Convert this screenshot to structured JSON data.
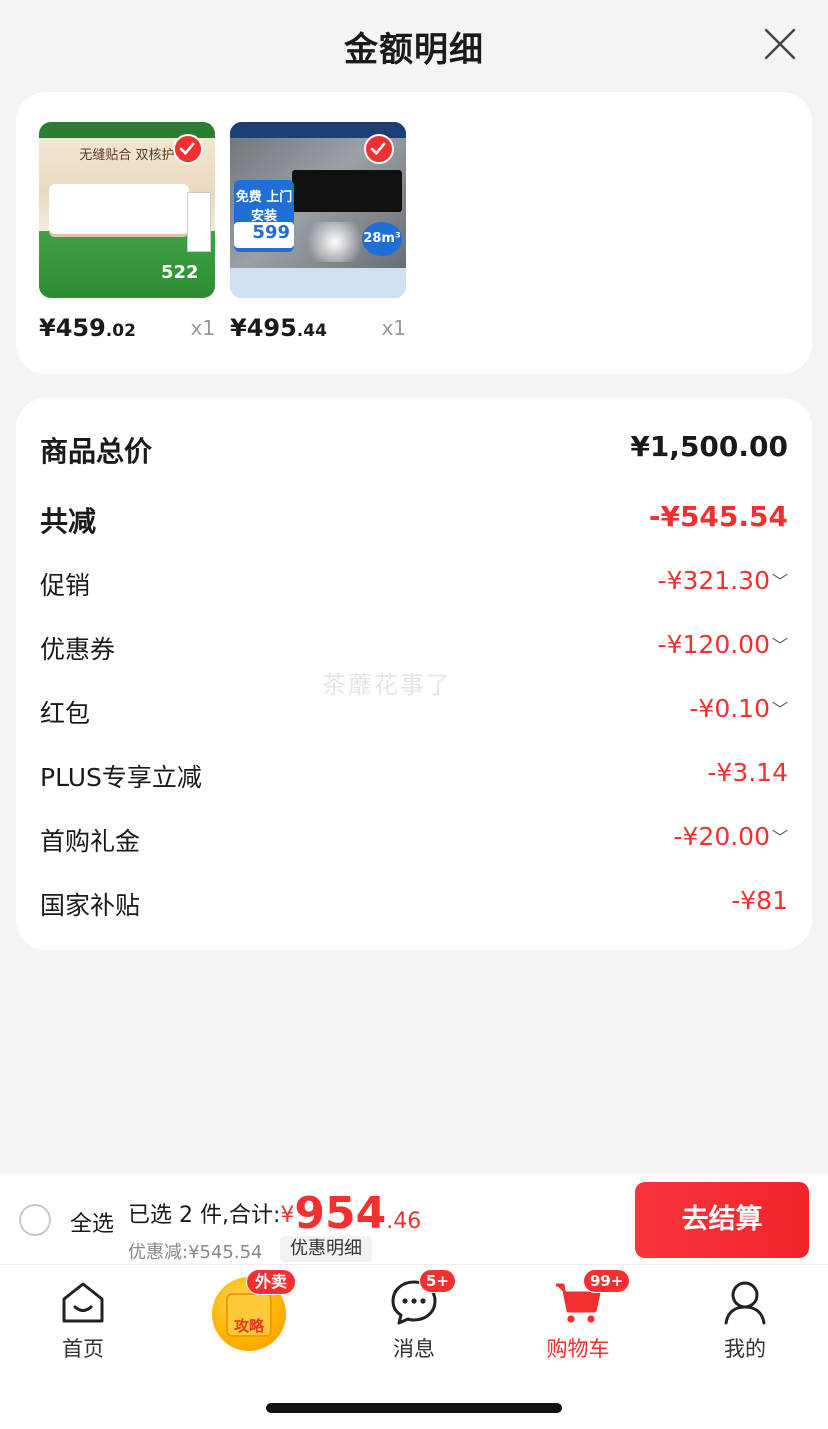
{
  "header": {
    "title": "金额明细"
  },
  "products": [
    {
      "price_main": "¥459",
      "price_dec": ".02",
      "qty": "x1",
      "checked": true,
      "thumb": {
        "headline": "无缝贴合 双核护",
        "badge": "522"
      }
    },
    {
      "price_main": "¥495",
      "price_dec": ".44",
      "qty": "x1",
      "checked": true,
      "thumb": {
        "headline": "免费 上门安装",
        "badge": "599",
        "extra": "28m³"
      }
    }
  ],
  "detail": {
    "total": {
      "label": "商品总价",
      "value": "¥1,500.00"
    },
    "reduce": {
      "label": "共减",
      "value": "-¥545.54"
    },
    "items": [
      {
        "label": "促销",
        "value": "-¥321.30",
        "chev": "﹀"
      },
      {
        "label": "优惠券",
        "value": "-¥120.00",
        "chev": "﹀"
      },
      {
        "label": "红包",
        "value": "-¥0.10",
        "chev": "﹀"
      },
      {
        "label": "PLUS专享立减",
        "value": "-¥3.14",
        "chev": ""
      },
      {
        "label": "首购礼金",
        "value": "-¥20.00",
        "chev": "﹀"
      },
      {
        "label": "国家补贴",
        "value": "-¥81",
        "chev": ""
      }
    ]
  },
  "watermark": "茶蘼花事了",
  "checkout": {
    "select_all": "全选",
    "selected": "已选 2 件,合计:",
    "currency": "¥",
    "total_int": "954",
    "total_dec": ".46",
    "discount": "优惠减:¥545.54",
    "discount_detail": "优惠明细",
    "button": "去结算"
  },
  "tabs": [
    {
      "label": "首页",
      "icon": "home-icon",
      "badge": ""
    },
    {
      "label": "",
      "icon": "promo-icon",
      "badge": "外卖",
      "promo_text": "攻略"
    },
    {
      "label": "消息",
      "icon": "message-icon",
      "badge": "5+"
    },
    {
      "label": "购物车",
      "icon": "cart-icon",
      "badge": "99+"
    },
    {
      "label": "我的",
      "icon": "user-icon",
      "badge": ""
    }
  ],
  "colors": {
    "accent": "#f23030",
    "background": "#f4f4f4",
    "card": "#ffffff"
  }
}
